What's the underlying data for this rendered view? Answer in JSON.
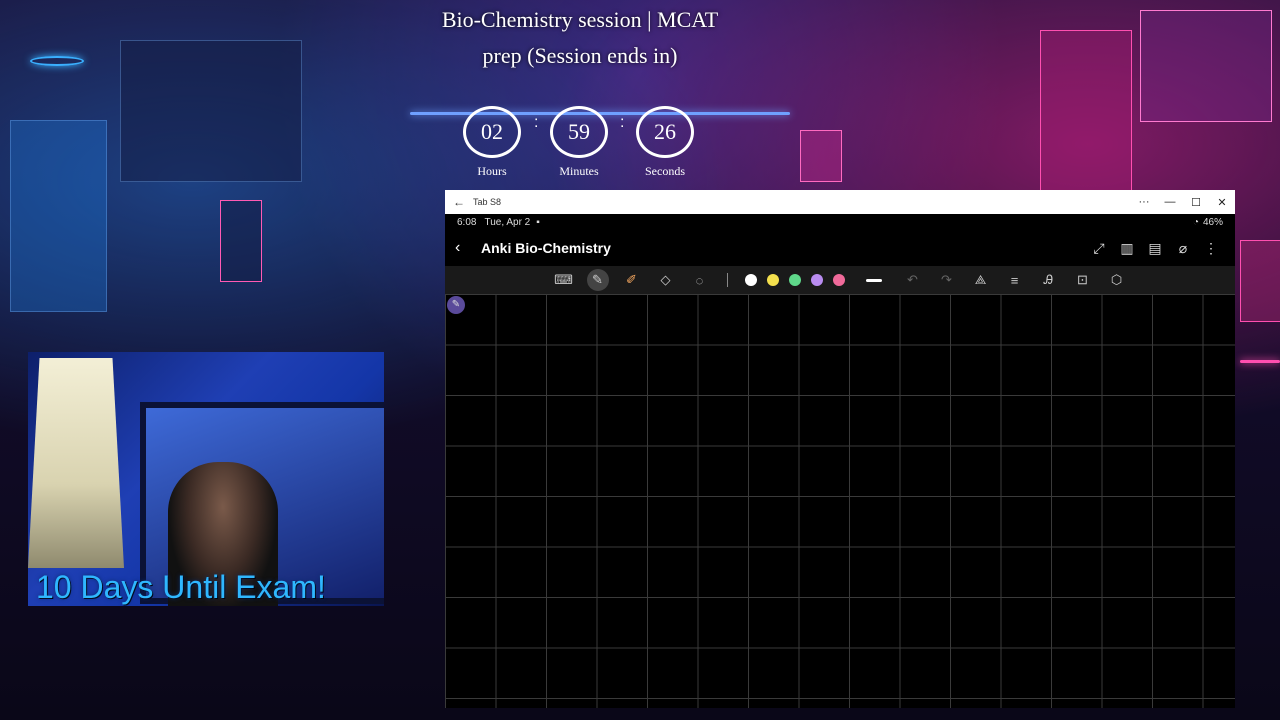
{
  "session": {
    "title": "Bio-Chemistry session | MCAT prep (Session ends in)",
    "timer": {
      "hours": "02",
      "hours_label": "Hours",
      "minutes": "59",
      "minutes_label": "Minutes",
      "seconds": "26",
      "seconds_label": "Seconds"
    }
  },
  "webcam": {
    "overlay_text": "10 Days Until Exam!"
  },
  "window": {
    "title": "Tab S8",
    "controls": {
      "more": "···",
      "minimize": "—",
      "maximize": "☐",
      "close": "✕"
    }
  },
  "device_status": {
    "time": "6:08",
    "date": "Tue, Apr 2",
    "battery": "46%"
  },
  "app": {
    "title": "Anki Bio-Chemistry"
  },
  "toolbar": {
    "pen_colors": [
      "#ffffff",
      "#f4e04d",
      "#5fd88a",
      "#b98cf0",
      "#f06a9a"
    ]
  },
  "icons": {
    "back": "back-arrow-icon",
    "expand": "expand-icon",
    "book": "book-icon",
    "page": "page-icon",
    "attach": "paperclip-icon",
    "more": "more-vert-icon"
  }
}
